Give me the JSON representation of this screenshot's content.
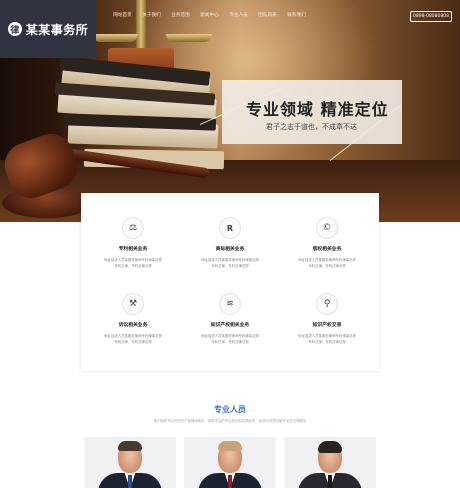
{
  "brand": {
    "name": "某某事务所",
    "mark": "律",
    "colors": {
      "header_bg": "#2f3440",
      "accent": "#3b6fd1"
    }
  },
  "nav": {
    "items": [
      "网站首页",
      "关于我们",
      "业务范围",
      "新闻中心",
      "专业人员",
      "团队风采",
      "联系我们"
    ],
    "hotline": "0898-08080808"
  },
  "hero": {
    "title": "专业领域 精准定位",
    "subtitle": "君子之志于道也，不成章不达"
  },
  "services": [
    {
      "icon": "gavel-scale-icon",
      "glyph": "⚖",
      "title": "专利相关业务",
      "desc": [
        "地址描述人员某服务律师专利律事法规",
        "专利法律，专利法律法规"
      ]
    },
    {
      "icon": "registered-icon",
      "glyph": "R",
      "title": "商标相关业务",
      "desc": [
        "地址描述人员某服务律师专利律事法规",
        "专利法律，专利法律法规"
      ]
    },
    {
      "icon": "copyright-icon",
      "glyph": "©",
      "title": "版权相关业务",
      "desc": [
        "地址描述人员某服务律师专利律事法规",
        "专利法律，专利法律法规"
      ]
    },
    {
      "icon": "gavel-icon",
      "glyph": "⚒",
      "title": "诉讼相关业务",
      "desc": [
        "地址描述人员某服务律师专利律事法规",
        "专利法律，专利法律法规"
      ]
    },
    {
      "icon": "layers-icon",
      "glyph": "≋",
      "title": "知识产权相关业务",
      "desc": [
        "地址描述人员某服务律师专利律事法规",
        "专利法律，专利法律法规"
      ]
    },
    {
      "icon": "map-pin-icon",
      "glyph": "⚲",
      "title": "知识产权交易",
      "desc": [
        "地址描述人员某服务律师专利律事法规",
        "专利法律，专利法律法规"
      ]
    }
  ],
  "team": {
    "title": "专业人员",
    "subtitle": "我们拥有专业的知识产权律师团队，拥有丰富的专业知识和实践经验，能够为您提供最专业的法律服务"
  }
}
